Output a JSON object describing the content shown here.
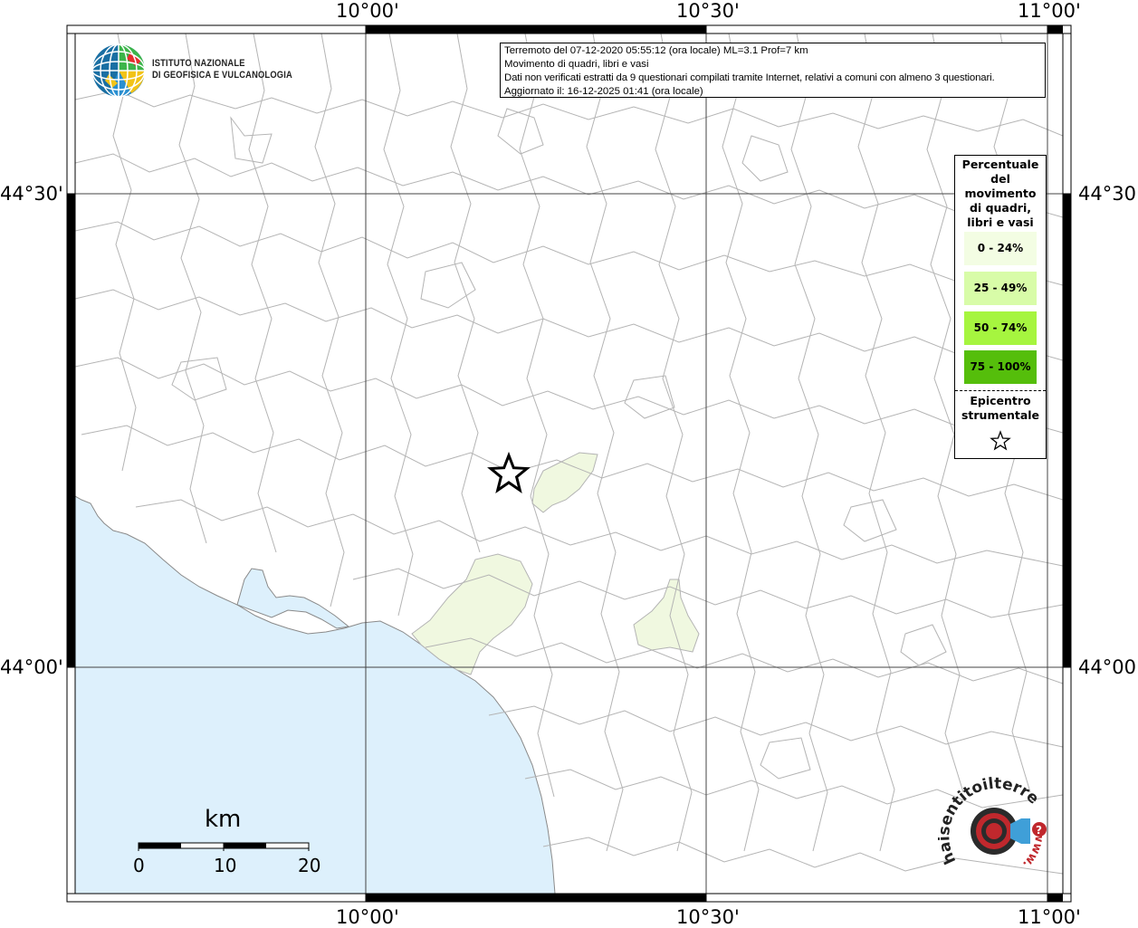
{
  "info": {
    "line1": "Terremoto del 07-12-2020 05:55:12 (ora locale) ML=3.1 Prof=7 km",
    "line2": "Movimento di quadri, libri e vasi",
    "line3": "Dati non verificati estratti da 9 questionari compilati tramite Internet, relativi a comuni con almeno 3 questionari.",
    "line4": "Aggiornato il: 16-12-2025 01:41 (ora locale)"
  },
  "institute": {
    "line1": "ISTITUTO NAZIONALE",
    "line2": "DI GEOFISICA E VULCANOLOGIA"
  },
  "axes": {
    "lon_labels": [
      "10°00'",
      "10°30'",
      "11°00'"
    ],
    "lat_labels": [
      "44°30'",
      "44°00'"
    ]
  },
  "legend": {
    "title": "Percentuale del movimento di quadri, libri e vasi",
    "title_lines": [
      "Percentuale",
      "del",
      "movimento",
      "di quadri,",
      "libri e vasi"
    ],
    "items": [
      {
        "label": "0 - 24%",
        "color": "#f3fde3"
      },
      {
        "label": "25 - 49%",
        "color": "#d8fca8"
      },
      {
        "label": "50 - 74%",
        "color": "#a6f53f"
      },
      {
        "label": "75 - 100%",
        "color": "#55be0b"
      }
    ],
    "epicenter_lines": [
      "Epicentro",
      "strumentale"
    ]
  },
  "scale": {
    "unit": "km",
    "ticks": [
      "0",
      "10",
      "20"
    ]
  },
  "colors": {
    "sea": "#ddf0fc",
    "border": "#b4b4b4",
    "grid": "#444444",
    "affected": "#f0f8e0"
  },
  "icons": {
    "epicenter": "star-outline-icon",
    "ingv_logo": "ingv-globe-logo",
    "haisentito_logo": "haisentitoilterremoto-logo"
  },
  "watermark": {
    "text": "haisentitoilterremoto.it",
    "prefix": "www."
  }
}
